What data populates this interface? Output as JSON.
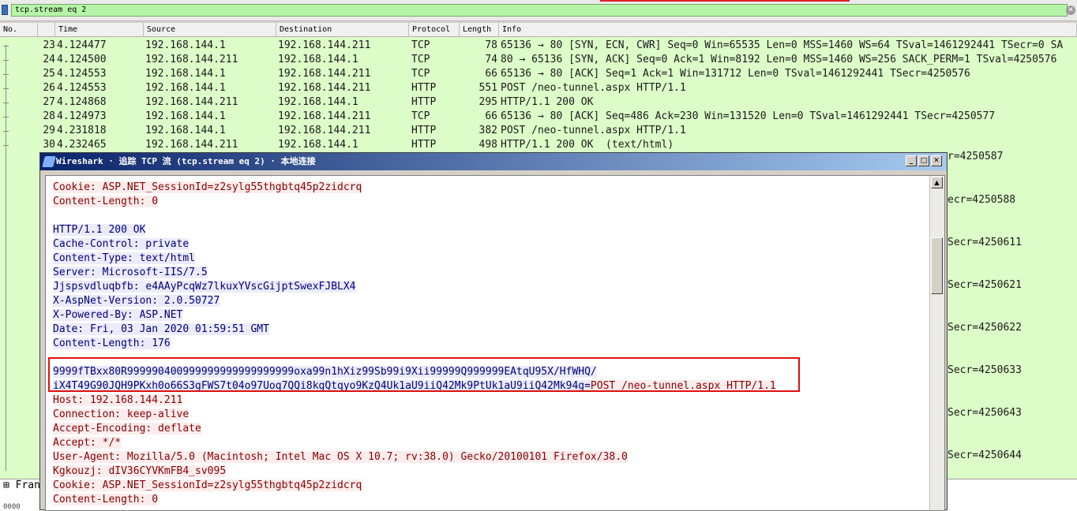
{
  "filter": {
    "value": "tcp.stream eq 2"
  },
  "columns": [
    "No.",
    "Time",
    "Source",
    "Destination",
    "Protocol",
    "Length",
    "Info"
  ],
  "packets": [
    {
      "no": "23",
      "time": "4.124477",
      "src": "192.168.144.1",
      "dst": "192.168.144.211",
      "proto": "TCP",
      "len": "78",
      "info": "65136 → 80 [SYN, ECN, CWR] Seq=0 Win=65535 Len=0 MSS=1460 WS=64 TSval=1461292441 TSecr=0 SA"
    },
    {
      "no": "24",
      "time": "4.124500",
      "src": "192.168.144.211",
      "dst": "192.168.144.1",
      "proto": "TCP",
      "len": "74",
      "info": "80 → 65136 [SYN, ACK] Seq=0 Ack=1 Win=8192 Len=0 MSS=1460 WS=256 SACK_PERM=1 TSval=4250576"
    },
    {
      "no": "25",
      "time": "4.124553",
      "src": "192.168.144.1",
      "dst": "192.168.144.211",
      "proto": "TCP",
      "len": "66",
      "info": "65136 → 80 [ACK] Seq=1 Ack=1 Win=131712 Len=0 TSval=1461292441 TSecr=4250576"
    },
    {
      "no": "26",
      "time": "4.124553",
      "src": "192.168.144.1",
      "dst": "192.168.144.211",
      "proto": "HTTP",
      "len": "551",
      "info": "POST /neo-tunnel.aspx HTTP/1.1"
    },
    {
      "no": "27",
      "time": "4.124868",
      "src": "192.168.144.211",
      "dst": "192.168.144.1",
      "proto": "HTTP",
      "len": "295",
      "info": "HTTP/1.1 200 OK"
    },
    {
      "no": "28",
      "time": "4.124973",
      "src": "192.168.144.1",
      "dst": "192.168.144.211",
      "proto": "TCP",
      "len": "66",
      "info": "65136 → 80 [ACK] Seq=486 Ack=230 Win=131520 Len=0 TSval=1461292441 TSecr=4250577"
    },
    {
      "no": "29",
      "time": "4.231818",
      "src": "192.168.144.1",
      "dst": "192.168.144.211",
      "proto": "HTTP",
      "len": "382",
      "info": "POST /neo-tunnel.aspx HTTP/1.1"
    },
    {
      "no": "30",
      "time": "4.232465",
      "src": "192.168.144.211",
      "dst": "192.168.144.1",
      "proto": "HTTP",
      "len": "498",
      "info": "HTTP/1.1 200 OK  (text/html)"
    }
  ],
  "partial_info": [
    "r=4250587",
    "ecr=4250588",
    "Secr=4250611",
    "Secr=4250621",
    "Secr=4250622",
    "Secr=4250633",
    "Secr=4250643",
    "Secr=4250644"
  ],
  "dialog": {
    "title": "Wireshark · 追踪 TCP 流 (tcp.stream eq 2) · 本地连接",
    "stream_lines": [
      {
        "t": "req",
        "text": "Cookie: ASP.NET_SessionId=z2sylg55thgbtq45p2zidcrq"
      },
      {
        "t": "req",
        "text": "Content-Length: 0"
      },
      {
        "t": "gap",
        "text": ""
      },
      {
        "t": "resp",
        "text": "HTTP/1.1 200 OK"
      },
      {
        "t": "resp",
        "text": "Cache-Control: private"
      },
      {
        "t": "resp",
        "text": "Content-Type: text/html"
      },
      {
        "t": "resp",
        "text": "Server: Microsoft-IIS/7.5"
      },
      {
        "t": "resp",
        "text": "Jjspsvdluqbfb: e4AAyPcqWz7lkuxYVscGijptSwexFJBLX4"
      },
      {
        "t": "resp",
        "text": "X-AspNet-Version: 2.0.50727"
      },
      {
        "t": "resp",
        "text": "X-Powered-By: ASP.NET"
      },
      {
        "t": "resp",
        "text": "Date: Fri, 03 Jan 2020 01:59:51 GMT"
      },
      {
        "t": "resp",
        "text": "Content-Length: 176"
      },
      {
        "t": "gap",
        "text": ""
      },
      {
        "t": "resp",
        "text": "9999fTBxx80R999990400999999999999999999oxa99n1hXiz99Sb99i9Xii99999Q999999EAtqU95X/HfWHQ/"
      },
      {
        "t": "mixed",
        "resp": "iX4T49G90JQH9PKxh0o66S3gFWS7t04o97Uoq7QQi8kgQtqyo9KzQ4Uk1aU9iiQ42Mk9PtUk1aU9iiQ42Mk94g=",
        "req": "POST /neo-tunnel.aspx HTTP/1.1"
      },
      {
        "t": "req",
        "text": "Host: 192.168.144.211"
      },
      {
        "t": "req",
        "text": "Connection: keep-alive"
      },
      {
        "t": "req",
        "text": "Accept-Encoding: deflate"
      },
      {
        "t": "req",
        "text": "Accept: */*"
      },
      {
        "t": "req",
        "text": "User-Agent: Mozilla/5.0 (Macintosh; Intel Mac OS X 10.7; rv:38.0) Gecko/20100101 Firefox/38.0"
      },
      {
        "t": "req",
        "text": "Kgkouzj: dIV36CYVKmFB4_sv095"
      },
      {
        "t": "req",
        "text": "Cookie: ASP.NET_SessionId=z2sylg55thgbtq45p2zidcrq"
      },
      {
        "t": "req",
        "text": "Content-Length: 0"
      }
    ]
  },
  "bottom": {
    "frame_label": "Fran",
    "hex_label": "0000"
  },
  "colors": {
    "packet_bg": "#dcfcc8",
    "request_text": "#8a0000",
    "response_text": "#00007a",
    "highlight": "#e01010"
  }
}
